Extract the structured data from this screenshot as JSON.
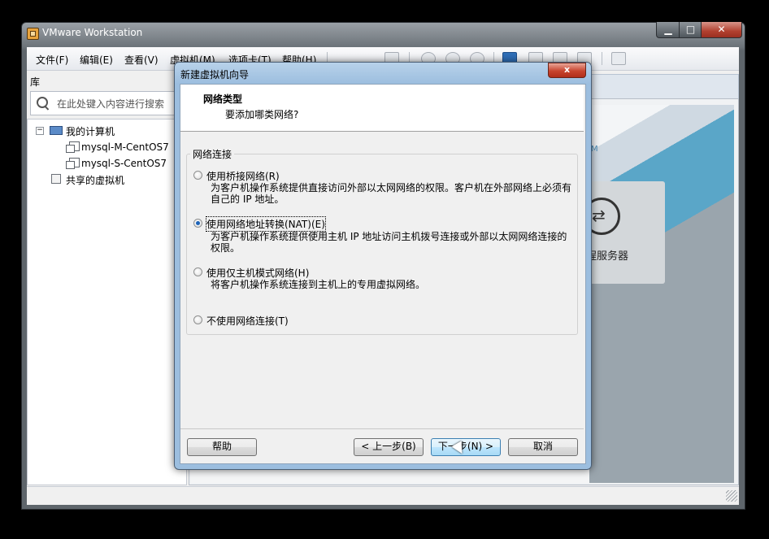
{
  "window": {
    "title": "VMware Workstation",
    "min_glyph": "▁",
    "max_glyph": "□",
    "close_glyph": "✕"
  },
  "menu": [
    "文件(F)",
    "编辑(E)",
    "查看(V)",
    "虚拟机(M)",
    "选项卡(T)",
    "帮助(H)"
  ],
  "library": {
    "title": "库",
    "search_placeholder": "在此处键入内容进行搜索",
    "tree": {
      "root": "我的计算机",
      "vms": [
        "mysql-M-CentOS7",
        "mysql-S-CentOS7"
      ],
      "shared": "共享的虚拟机"
    }
  },
  "home": {
    "remote_label": "程服务器",
    "hint": "M"
  },
  "dialog": {
    "title": "新建虚拟机向导",
    "close_glyph": "x",
    "header_title": "网络类型",
    "header_subtitle": "要添加哪类网络?",
    "group_label": "网络连接",
    "options": [
      {
        "label": "使用桥接网络(R)",
        "desc": "为客户机操作系统提供直接访问外部以太网网络的权限。客户机在外部网络上必须有自己的 IP 地址。",
        "checked": false
      },
      {
        "label": "使用网络地址转换(NAT)(E)",
        "desc": "为客户机操作系统提供使用主机 IP 地址访问主机拨号连接或外部以太网网络连接的权限。",
        "checked": true
      },
      {
        "label": "使用仅主机模式网络(H)",
        "desc": "将客户机操作系统连接到主机上的专用虚拟网络。",
        "checked": false
      },
      {
        "label": "不使用网络连接(T)",
        "desc": "",
        "checked": false
      }
    ],
    "buttons": {
      "help": "帮助",
      "back": "< 上一步(B)",
      "next": "下一步(N) >",
      "cancel": "取消"
    }
  }
}
